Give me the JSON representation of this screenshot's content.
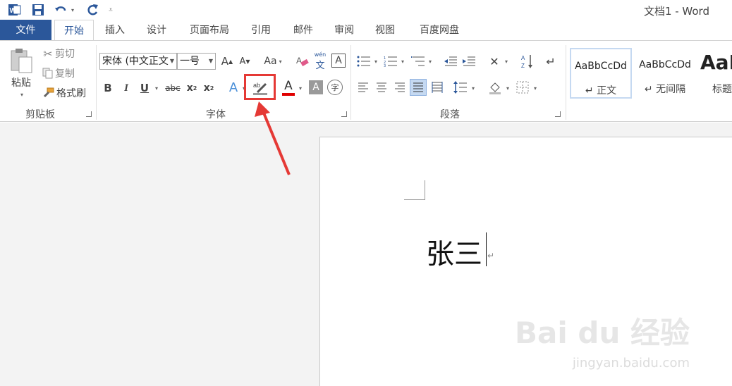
{
  "window": {
    "title": "文档1 - Word"
  },
  "quick_access": {
    "customize_glyph": "₹"
  },
  "tabs": {
    "file": "文件",
    "items": [
      "开始",
      "插入",
      "设计",
      "页面布局",
      "引用",
      "邮件",
      "审阅",
      "视图",
      "百度网盘"
    ],
    "active": "开始"
  },
  "clipboard": {
    "paste": "粘贴",
    "cut": "剪切",
    "copy": "复制",
    "format_painter": "格式刷",
    "label": "剪贴板"
  },
  "font": {
    "font_name": "宋体 (中文正文",
    "font_size": "一号",
    "label": "字体",
    "case_label": "Aa",
    "phonetic": "wén"
  },
  "paragraph": {
    "label": "段落"
  },
  "styles": {
    "items": [
      {
        "sample": "AaBbCcDd",
        "name": "↵ 正文"
      },
      {
        "sample": "AaBbCcDd",
        "name": "↵ 无间隔"
      },
      {
        "sample": "AaI",
        "name": "标题"
      }
    ]
  },
  "document": {
    "text": "张三",
    "paragraph_mark": "↵"
  },
  "watermark": {
    "brand": "Bai du 经验",
    "url": "jingyan.baidu.com"
  },
  "colors": {
    "accent": "#2b579a",
    "highlight_frame": "#e53935",
    "arrow": "#e53935",
    "font_color_bar": "#e00000"
  }
}
